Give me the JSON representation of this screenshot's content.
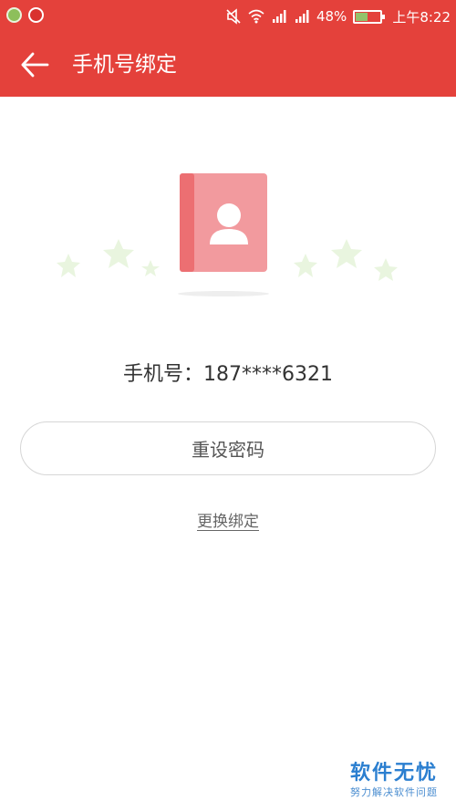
{
  "status_bar": {
    "battery_percent": "48%",
    "battery_level": 0.48,
    "time": "上午8:22",
    "icons": [
      "app-icon-green",
      "app-icon-red",
      "mute-icon",
      "wifi-icon",
      "signal-icon",
      "signal-icon",
      "battery-icon"
    ]
  },
  "app_bar": {
    "title": "手机号绑定",
    "back_icon": "arrow-left-icon"
  },
  "illustration": {
    "book_icon": "contact-book-icon",
    "colors": {
      "book": "#f29a9e",
      "spine": "#ec6f72",
      "stars": "#e9f5df"
    }
  },
  "main": {
    "phone_label": "手机号：187****6321",
    "reset_button": "重设密码",
    "change_link": "更换绑定"
  },
  "watermark": {
    "title": "软件无忧",
    "subtitle": "努力解决软件问题"
  },
  "colors": {
    "accent": "#e4413b",
    "watermark": "#2b7fd0"
  }
}
